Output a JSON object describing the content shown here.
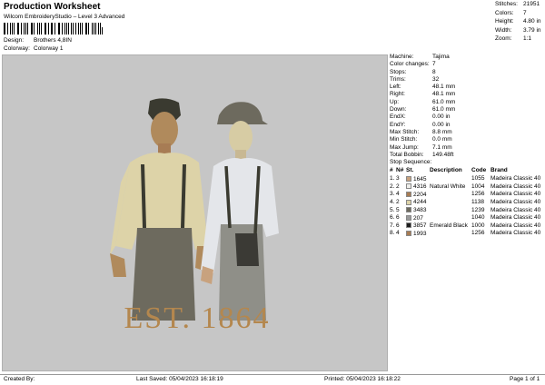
{
  "header": {
    "title": "Production Worksheet",
    "subtitle": "Wilcom EmbroideryStudio – Level 3 Advanced",
    "design_label": "Design:",
    "design_value": "Brothers 4,8IN",
    "colorway_label": "Colorway:",
    "colorway_value": "Colorway 1"
  },
  "stats": [
    {
      "label": "Stitches:",
      "value": "21951"
    },
    {
      "label": "Colors:",
      "value": "7"
    },
    {
      "label": "Height:",
      "value": "4.80 in"
    },
    {
      "label": "Width:",
      "value": "3.79 in"
    },
    {
      "label": "Zoom:",
      "value": "1:1"
    }
  ],
  "machine_info": [
    {
      "label": "Machine:",
      "value": "Tajima"
    },
    {
      "label": "Color changes:",
      "value": "7"
    },
    {
      "label": "Stops:",
      "value": "8"
    },
    {
      "label": "Trims:",
      "value": "32"
    },
    {
      "label": "Left:",
      "value": "48.1 mm"
    },
    {
      "label": "Right:",
      "value": "48.1 mm"
    },
    {
      "label": "Up:",
      "value": "61.0 mm"
    },
    {
      "label": "Down:",
      "value": "61.0 mm"
    },
    {
      "label": "EndX:",
      "value": "0.00 in"
    },
    {
      "label": "EndY:",
      "value": "0.00 in"
    },
    {
      "label": "Max Stitch:",
      "value": "8.8 mm"
    },
    {
      "label": "Min Stitch:",
      "value": "0.0 mm"
    },
    {
      "label": "Max Jump:",
      "value": "7.1 mm"
    },
    {
      "label": "Total Bobbin:",
      "value": "149.48ft"
    }
  ],
  "stop_sequence": {
    "title": "Stop Sequence:",
    "headers": [
      "#",
      "N#",
      "St.",
      "Description",
      "Code",
      "Brand"
    ],
    "rows": [
      {
        "num": "1.",
        "n": "3",
        "st": "1645",
        "desc": "",
        "code": "1055",
        "brand": "Madeira Classic 40",
        "color": "#c8a27e"
      },
      {
        "num": "2.",
        "n": "2",
        "st": "4316",
        "desc": "Natural White",
        "code": "1004",
        "brand": "Madeira Classic 40",
        "color": "#eeeeea"
      },
      {
        "num": "3.",
        "n": "4",
        "st": "2204",
        "desc": "",
        "code": "1256",
        "brand": "Madeira Classic 40",
        "color": "#a77c54"
      },
      {
        "num": "4.",
        "n": "2",
        "st": "4244",
        "desc": "",
        "code": "1138",
        "brand": "Madeira Classic 40",
        "color": "#ddd3a8"
      },
      {
        "num": "5.",
        "n": "5",
        "st": "3483",
        "desc": "",
        "code": "1239",
        "brand": "Madeira Classic 40",
        "color": "#6d6a5e"
      },
      {
        "num": "6.",
        "n": "6",
        "st": "207",
        "desc": "",
        "code": "1040",
        "brand": "Madeira Classic 40",
        "color": "#9a9a9a"
      },
      {
        "num": "7.",
        "n": "6",
        "st": "3857",
        "desc": "Emerald Black",
        "code": "1000",
        "brand": "Madeira Classic 40",
        "color": "#1e1e1e"
      },
      {
        "num": "8.",
        "n": "4",
        "st": "1993",
        "desc": "",
        "code": "1256",
        "brand": "Madeira Classic 40",
        "color": "#a77c54"
      }
    ]
  },
  "design": {
    "text": "EST. 1864"
  },
  "footer": {
    "created_by": "Created By:",
    "last_saved": "Last Saved: 05/04/2023 16:18:19",
    "printed": "Printed: 05/04/2023 16:18:22",
    "page": "Page 1 of 1"
  }
}
